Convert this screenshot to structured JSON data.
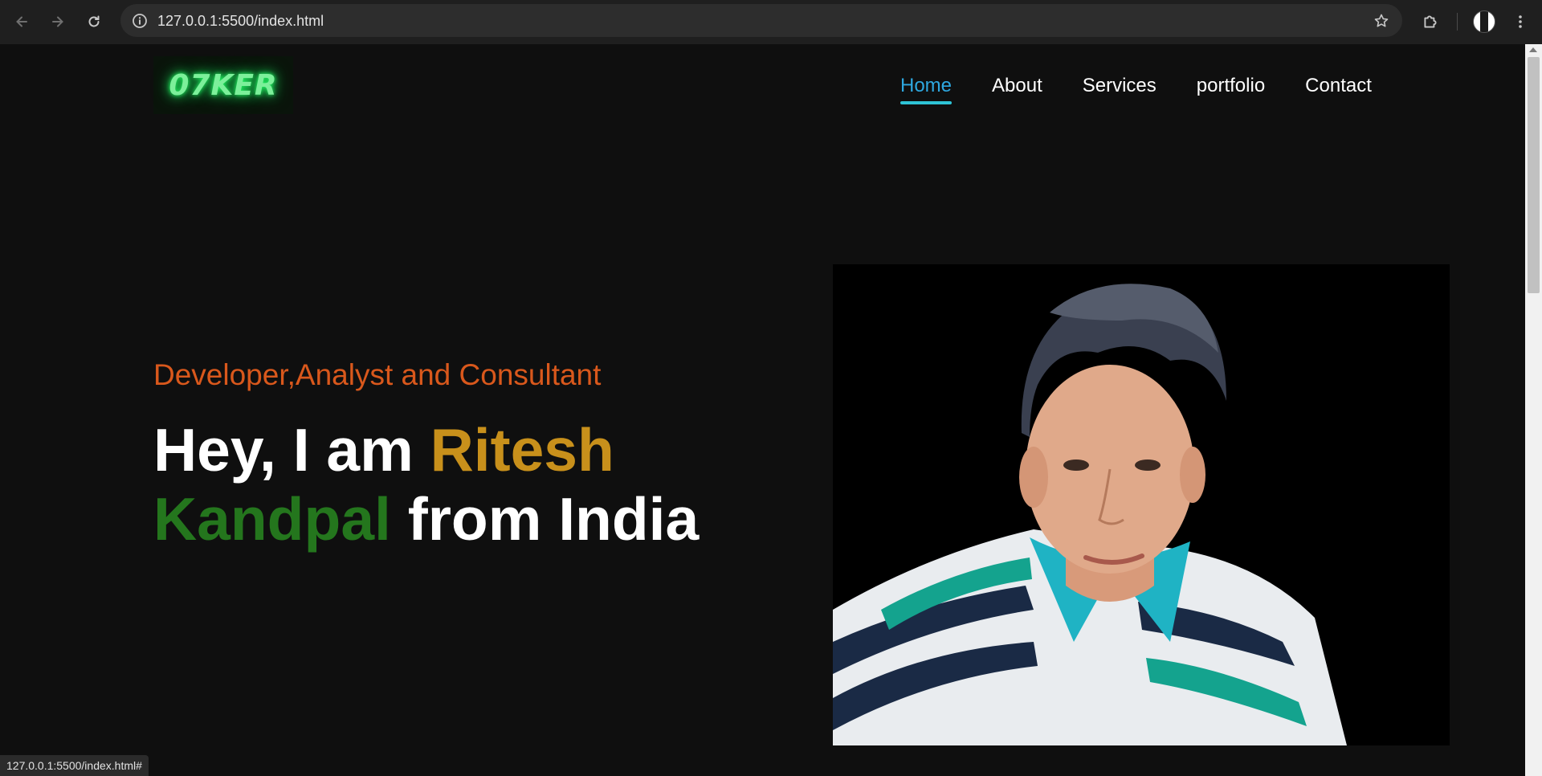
{
  "browser": {
    "url": "127.0.0.1:5500/index.html",
    "status_url": "127.0.0.1:5500/index.html#",
    "icons": {
      "back": "back-arrow-icon",
      "forward": "forward-arrow-icon",
      "reload": "reload-icon",
      "site_info": "info-icon",
      "bookmark": "star-icon",
      "extensions": "puzzle-icon",
      "profile": "profile-avatar",
      "menu": "more-vertical-icon"
    }
  },
  "site": {
    "logo": "07KER",
    "nav": [
      {
        "label": "Home",
        "active": true
      },
      {
        "label": "About",
        "active": false
      },
      {
        "label": "Services",
        "active": false
      },
      {
        "label": "portfolio",
        "active": false
      },
      {
        "label": "Contact",
        "active": false
      }
    ],
    "hero": {
      "tagline": "Developer,Analyst and Consultant",
      "greeting": "Hey, I am ",
      "first_name": "Ritesh",
      "last_name": "Kandpal",
      "suffix": " from India"
    },
    "colors": {
      "background": "#0f0f0f",
      "tagline": "#d9581c",
      "first_name": "#c8901b",
      "last_name": "#24761d",
      "nav_active": "#2ea8e0",
      "logo_glow": "#22ff66"
    }
  }
}
